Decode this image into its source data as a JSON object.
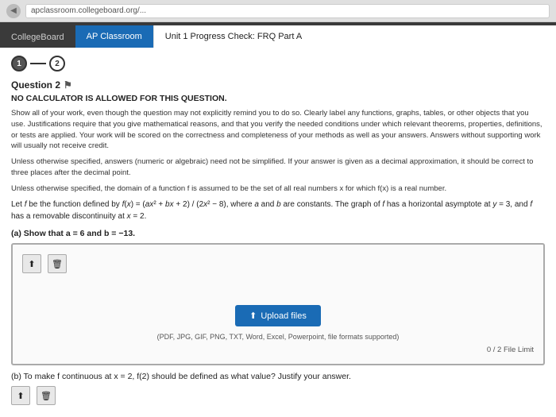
{
  "browser": {
    "url": "apclassroom.collegeboard.org/..."
  },
  "tabs": [
    {
      "id": "collegeboard",
      "label": "CollegeBoard",
      "active": false,
      "ap": false
    },
    {
      "id": "ap-classroom",
      "label": "AP Classroom",
      "active": false,
      "ap": true
    }
  ],
  "page_title": "Unit 1 Progress Check: FRQ Part A",
  "steps": [
    {
      "label": "1",
      "done": true
    },
    {
      "label": "2",
      "done": false
    }
  ],
  "question": {
    "number": "Question 2",
    "no_calc": "NO CALCULATOR IS ALLOWED FOR THIS QUESTION.",
    "instructions": [
      "Show all of your work, even though the question may not explicitly remind you to do so. Clearly label any functions, graphs, tables, or other objects that you use. Justifications require that you give mathematical reasons, and that you verify the needed conditions under which relevant theorems, properties, definitions, or tests are applied. Your work will be scored on the correctness and completeness of your methods as well as your answers. Answers without supporting work will usually not receive credit.",
      "Unless otherwise specified, answers (numeric or algebraic) need not be simplified. If your answer is given as a decimal approximation, it should be correct to three places after the decimal point.",
      "Unless otherwise specified, the domain of a function f is assumed to be the set of all real numbers x for which f(x) is a real number."
    ],
    "problem_text": "Let f be the function defined by f(x) = (ax² + bx + 2) / (2x² - 8), where a and b are constants. The graph of f has a horizontal asymptote at y = 3, and f has a removable discontinuity at x = 2.",
    "part_a": {
      "label": "(a) Show that a = 6 and b = −13."
    },
    "part_b": {
      "label": "(b) To make f continuous at x = 2, f(2) should be defined as what value? Justify your answer."
    }
  },
  "upload": {
    "button_label": "Upload files",
    "formats_text": "(PDF, JPG, GIF, PNG, TXT, Word, Excel, Powerpoint, file formats supported)",
    "file_limit": "0 / 2 File Limit"
  },
  "toolbar": {
    "upload_icon": "⬆",
    "trash_icon": "🗑"
  }
}
